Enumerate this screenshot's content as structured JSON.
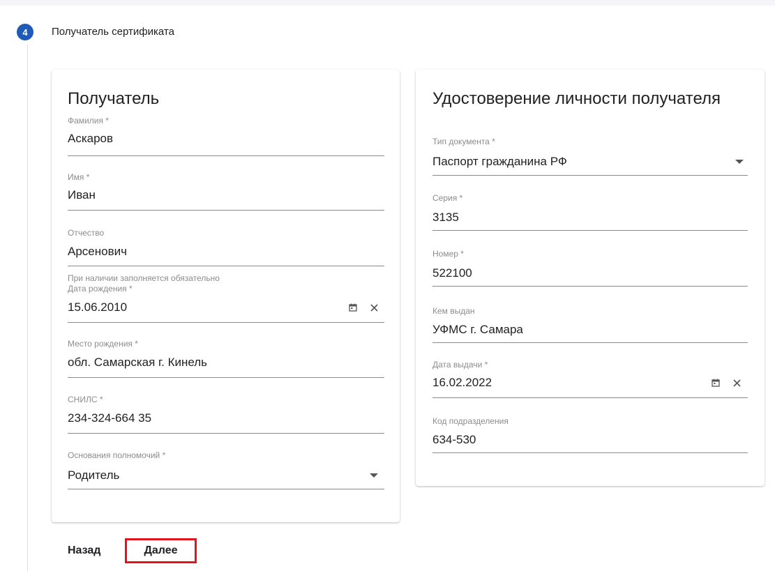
{
  "step": {
    "number": "4",
    "title": "Получатель сертификата"
  },
  "recipient": {
    "title": "Получатель",
    "last_name": {
      "label": "Фамилия *",
      "value": "Аскаров"
    },
    "first_name": {
      "label": "Имя *",
      "value": "Иван"
    },
    "patronymic": {
      "label": "Отчество",
      "value": "Арсенович",
      "hint": "При наличии заполняется обязательно"
    },
    "birth_date": {
      "label": "Дата рождения *",
      "value": "15.06.2010"
    },
    "birth_place": {
      "label": "Место рождения *",
      "value": "обл. Самарская г. Кинель"
    },
    "snils": {
      "label": "СНИЛС *",
      "value": "234-324-664 35"
    },
    "authority": {
      "label": "Основания полномочий *",
      "value": "Родитель"
    }
  },
  "identity": {
    "title": "Удостоверение личности получателя",
    "doc_type": {
      "label": "Тип документа *",
      "value": "Паспорт гражданина РФ"
    },
    "series": {
      "label": "Серия *",
      "value": "3135"
    },
    "number": {
      "label": "Номер *",
      "value": "522100"
    },
    "issued_by": {
      "label": "Кем выдан",
      "value": "УФМС г. Самара"
    },
    "issue_date": {
      "label": "Дата выдачи *",
      "value": "16.02.2022"
    },
    "division_code": {
      "label": "Код подразделения",
      "value": "634-530"
    }
  },
  "actions": {
    "back": "Назад",
    "next": "Далее"
  },
  "colors": {
    "accent": "#1e5bb8",
    "highlight": "#e3141c"
  },
  "icons": {
    "calendar": "calendar-icon",
    "clear": "close-icon",
    "dropdown": "caret-down-icon"
  }
}
